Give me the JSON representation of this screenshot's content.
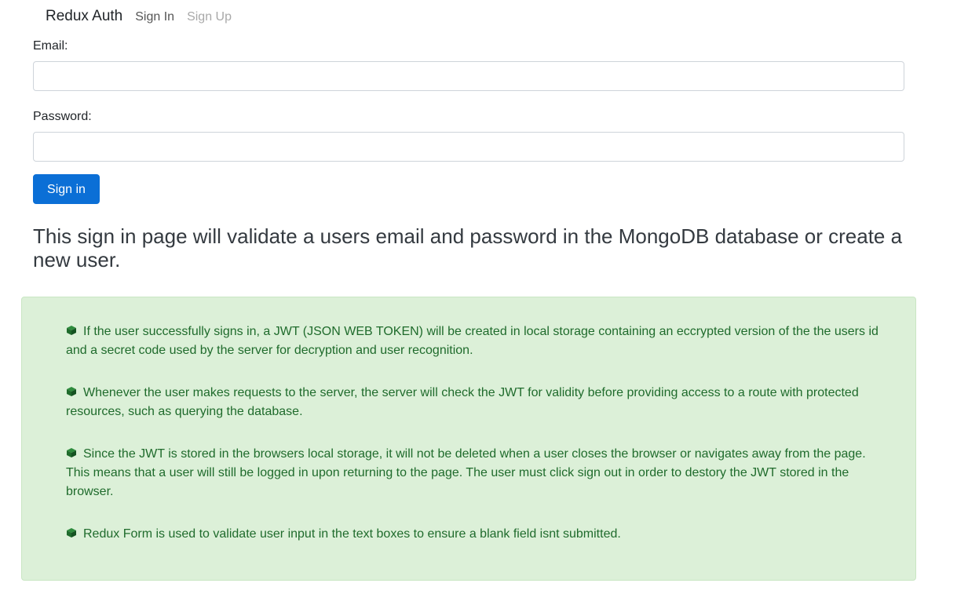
{
  "navbar": {
    "brand": "Redux Auth",
    "links": [
      {
        "label": "Sign In"
      },
      {
        "label": "Sign Up"
      }
    ]
  },
  "form": {
    "email_label": "Email:",
    "email_value": "",
    "password_label": "Password:",
    "password_value": "",
    "submit_label": "Sign in"
  },
  "info": {
    "heading": "This sign in page will validate a users email and password in the MongoDB database or create a new user.",
    "icon": "cube-icon",
    "points": [
      "If the user successfully signs in, a JWT (JSON WEB TOKEN) will be created in local storage containing an eccrypted version of the the users id and a secret code used by the server for decryption and user recognition.",
      "Whenever the user makes requests to the server, the server will check the JWT for validity before providing access to a route with protected resources, such as querying the database.",
      "Since the JWT is stored in the browsers local storage, it will not be deleted when a user closes the browser or navigates away from the page. This means that a user will still be logged in upon returning to the page. The user must click sign out in order to destory the JWT stored in the browser.",
      "Redux Form is used to validate user input in the text boxes to ensure a blank field isnt submitted."
    ]
  },
  "colors": {
    "primary": "#0b6fd6",
    "alert_bg": "#dcf0d8",
    "alert_text": "#1f6b2c"
  }
}
